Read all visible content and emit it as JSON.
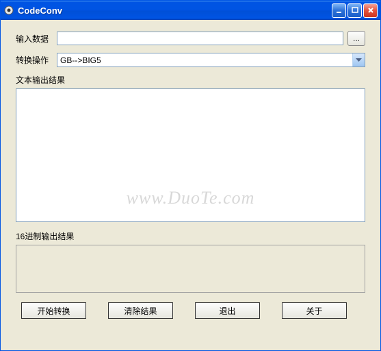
{
  "window": {
    "title": "CodeConv"
  },
  "labels": {
    "input_data": "输入数据",
    "convert_op": "转换操作",
    "text_output": "文本输出结果",
    "hex_output": "16进制输出结果"
  },
  "fields": {
    "input_value": "",
    "convert_selected": "GB-->BIG5",
    "text_output_value": "",
    "hex_output_value": ""
  },
  "buttons": {
    "browse": "...",
    "start": "开始转换",
    "clear": "清除结果",
    "exit": "退出",
    "about": "关于"
  },
  "watermark": "www.DuoTe.com"
}
